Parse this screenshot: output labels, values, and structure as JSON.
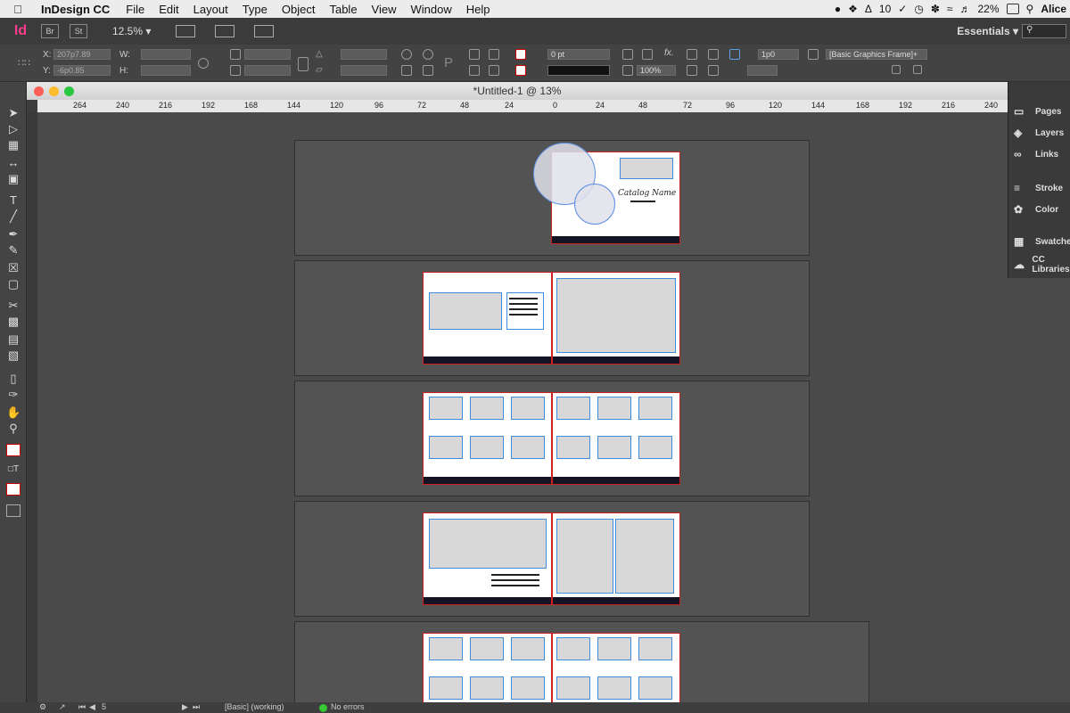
{
  "menubar": {
    "app_name": "InDesign CC",
    "items": [
      "File",
      "Edit",
      "Layout",
      "Type",
      "Object",
      "Table",
      "View",
      "Window",
      "Help"
    ],
    "right": {
      "adobe_count": "10",
      "battery": "22%",
      "user": "Alice"
    }
  },
  "appbar": {
    "app_icon": "Id",
    "bridge": "Br",
    "stock": "St",
    "zoom": "12.5%",
    "workspace": "Essentials"
  },
  "control": {
    "x_label": "X:",
    "x_value": "207p7.89",
    "y_label": "Y:",
    "y_value": "-6p0.85",
    "w_label": "W:",
    "h_label": "H:",
    "stroke_weight": "0 pt",
    "opacity": "100%",
    "corner": "1p0",
    "object_style": "[Basic Graphics Frame]+"
  },
  "document": {
    "title": "*Untitled-1 @ 13%",
    "cover_text": "Catalog Name"
  },
  "ruler": {
    "ticks": [
      "264",
      "240",
      "216",
      "192",
      "168",
      "144",
      "120",
      "96",
      "72",
      "48",
      "24",
      "0",
      "24",
      "48",
      "72",
      "96",
      "120",
      "144",
      "168",
      "192",
      "216",
      "240"
    ]
  },
  "panels": [
    {
      "label": "Pages",
      "icon": "pages-icon"
    },
    {
      "label": "Layers",
      "icon": "layers-icon"
    },
    {
      "label": "Links",
      "icon": "links-icon"
    },
    {
      "label": "Stroke",
      "icon": "stroke-icon"
    },
    {
      "label": "Color",
      "icon": "color-icon"
    },
    {
      "label": "Swatches",
      "icon": "swatches-icon"
    },
    {
      "label": "CC Libraries",
      "icon": "cc-libraries-icon"
    }
  ],
  "status": {
    "page": "5",
    "preflight_profile": "[Basic] (working)",
    "errors": "No errors"
  }
}
